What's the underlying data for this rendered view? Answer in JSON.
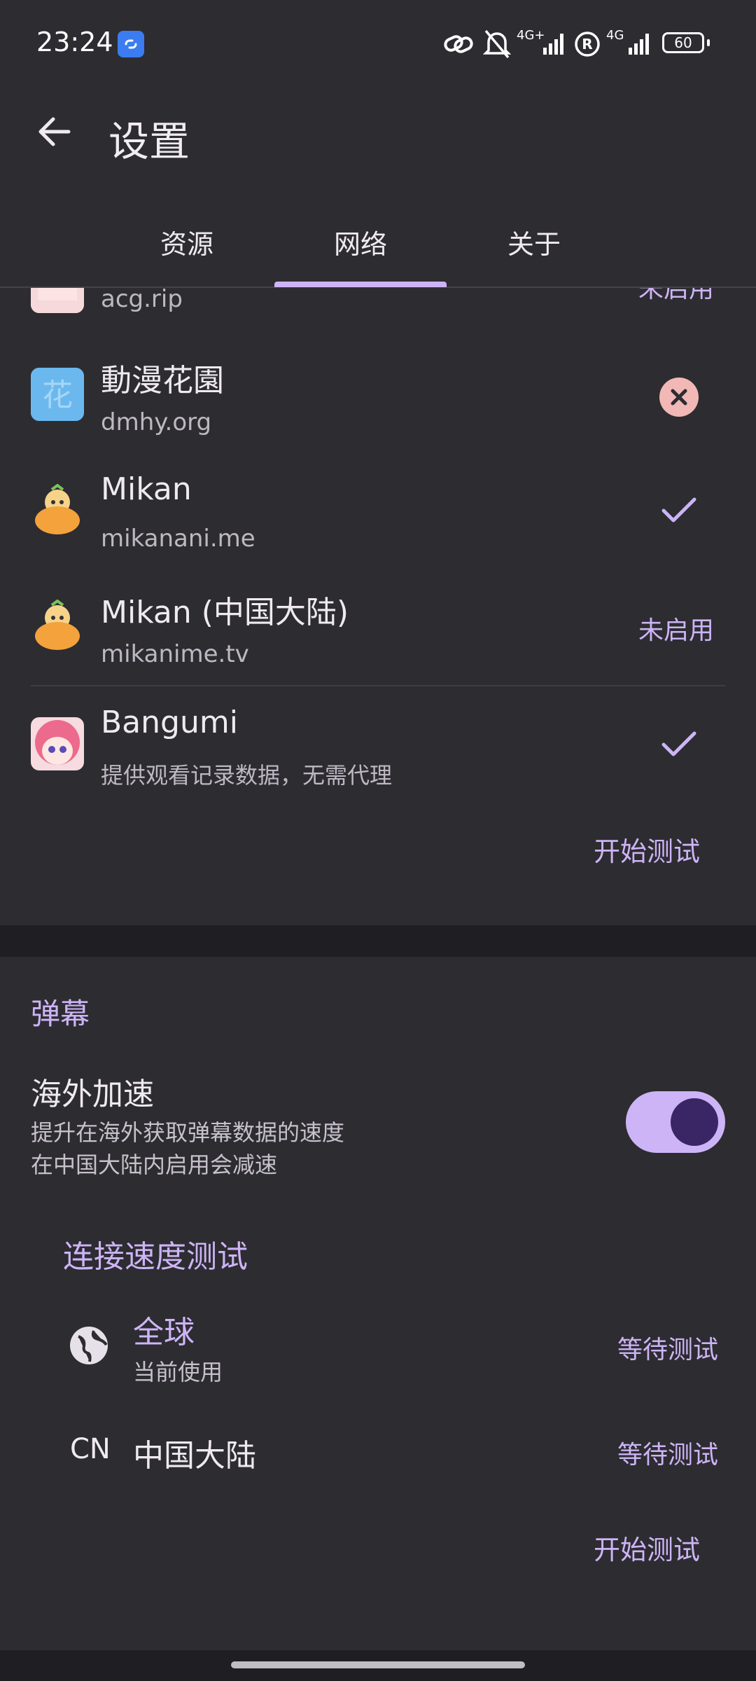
{
  "status_bar": {
    "time": "23:24",
    "network_1": "4G+",
    "network_2": "4G",
    "battery": "60",
    "icons": [
      "link-icon",
      "mute-bell-icon",
      "signal-icon",
      "registered-icon",
      "signal-icon",
      "battery-icon"
    ]
  },
  "header": {
    "title": "设置"
  },
  "tabs": [
    {
      "label": "资源",
      "active": false
    },
    {
      "label": "网络",
      "active": true
    },
    {
      "label": "关于",
      "active": false
    }
  ],
  "sources": [
    {
      "name": "",
      "host": "acg.rip",
      "status": "未启用",
      "status_type": "text",
      "icon": "acg-avatar"
    },
    {
      "name": "動漫花園",
      "host": "dmhy.org",
      "status_type": "error",
      "icon": "dmhy-logo"
    },
    {
      "name": "Mikan",
      "host": "mikanani.me",
      "status_type": "check",
      "icon": "mikan-mascot"
    },
    {
      "name": "Mikan (中国大陆)",
      "host": "mikanime.tv",
      "status": "未启用",
      "status_type": "text",
      "icon": "mikan-mascot"
    },
    {
      "name": "Bangumi",
      "host": "提供观看记录数据，无需代理",
      "status_type": "check",
      "icon": "bangumi-avatar"
    }
  ],
  "sources_action": "开始测试",
  "danmaku": {
    "section_title": "弹幕",
    "overseas": {
      "title": "海外加速",
      "desc_line1": "提升在海外获取弹幕数据的速度",
      "desc_line2": "在中国大陆内启用会减速",
      "enabled": true
    },
    "speed_test": {
      "title": "连接速度测试",
      "items": [
        {
          "label": "全球",
          "sub": "当前使用",
          "status": "等待测试",
          "icon": "globe-icon"
        },
        {
          "prefix": "CN",
          "label": "中国大陆",
          "status": "等待测试"
        }
      ],
      "action": "开始测试"
    }
  },
  "colors": {
    "accent": "#cdb4f6",
    "surface": "#2d2c31",
    "background": "#1e1e23",
    "error": "#f2b8b5"
  }
}
